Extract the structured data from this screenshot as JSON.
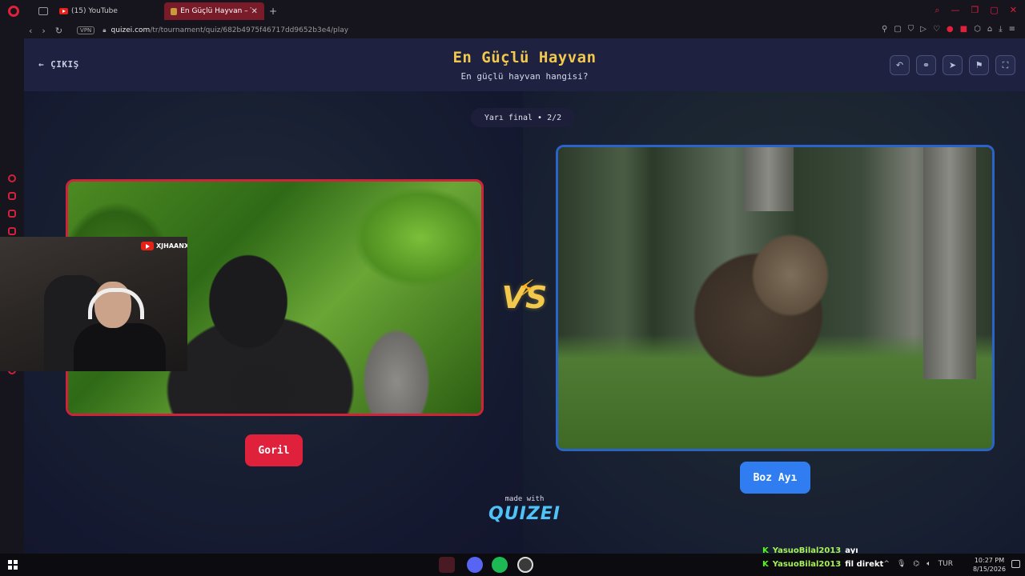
{
  "browser": {
    "tabs": [
      {
        "label": "(15) YouTube",
        "active": false
      },
      {
        "label": "En Güçlü Hayvan – Tier List",
        "active": true
      }
    ],
    "new_tab": "+",
    "url_host": "quizei.com",
    "url_path": "/tr/tournament/quiz/682b4975f46717dd9652b3e4/play",
    "vpn_label": "VPN"
  },
  "header": {
    "exit_label": "ÇIKIŞ",
    "title": "En Güçlü Hayvan",
    "subtitle": "En güçlü hayvan hangisi?"
  },
  "round": {
    "label": "Yarı final • 2/2"
  },
  "vs_label": "VS",
  "choices": [
    {
      "label": "Goril",
      "image": "gorilla",
      "color": "#e0213b"
    },
    {
      "label": "Boz Ayı",
      "image": "brown-bear",
      "color": "#2f7df0"
    }
  ],
  "footer": {
    "made_with": "made with",
    "brand": "QUIZEI"
  },
  "webcam": {
    "channel": "XJHAANX"
  },
  "chat": [
    {
      "user": "YasuoBilal2013",
      "message": "ayı"
    },
    {
      "user": "YasuoBilal2013",
      "message": "fil direkt"
    }
  ],
  "taskbar": {
    "language": "TUR",
    "time": "10:27 PM",
    "date": "8/15/2026"
  },
  "colors": {
    "accent_red": "#e0213b",
    "accent_blue": "#2f7df0",
    "title_gold": "#f2c94c"
  }
}
